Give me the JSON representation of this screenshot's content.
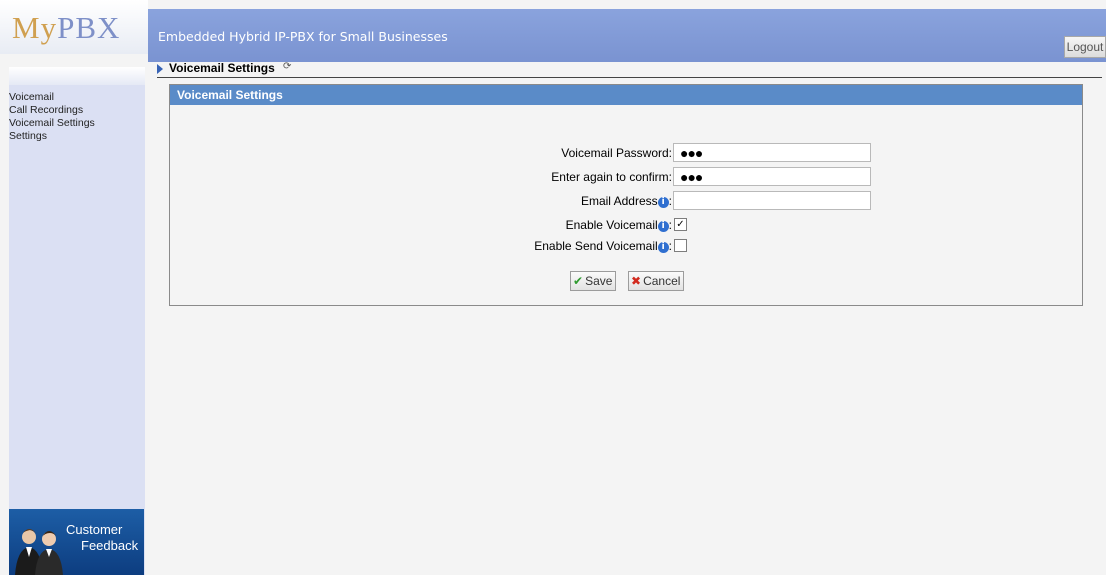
{
  "logo": {
    "prefix": "My",
    "suffix": "PBX"
  },
  "header": {
    "tagline": "Embedded Hybrid IP-PBX for Small Businesses",
    "logout_label": "Logout"
  },
  "sidebar": {
    "items": [
      {
        "label": "Voicemail"
      },
      {
        "label": "Call Recordings"
      },
      {
        "label": "Voicemail Settings"
      },
      {
        "label": "Settings"
      }
    ],
    "feedback": {
      "line1": "Customer",
      "line2": "Feedback"
    }
  },
  "breadcrumb": {
    "title": "Voicemail Settings"
  },
  "panel": {
    "title": "Voicemail Settings",
    "fields": {
      "password": {
        "label": "Voicemail Password:",
        "value": "●●●"
      },
      "confirm": {
        "label": "Enter again to confirm:",
        "value": "●●●"
      },
      "email": {
        "label": "Email Address",
        "value": ""
      },
      "enable_voicemail": {
        "label": "Enable Voicemail",
        "checked": true
      },
      "enable_send": {
        "label": "Enable Send Voicemail",
        "checked": false
      }
    },
    "buttons": {
      "save": "Save",
      "cancel": "Cancel"
    }
  },
  "colors": {
    "header_bg": "#7a93d1",
    "panel_header_bg": "#5a8bc8",
    "sidebar_bg": "#dbe0f3",
    "save_icon": "#2e9a2e",
    "cancel_icon": "#d22a1e"
  },
  "icons": {
    "breadcrumb": "triangle-right-icon",
    "refresh": "refresh-icon",
    "info": "info-icon",
    "save": "checkmark-icon",
    "cancel": "x-icon"
  }
}
